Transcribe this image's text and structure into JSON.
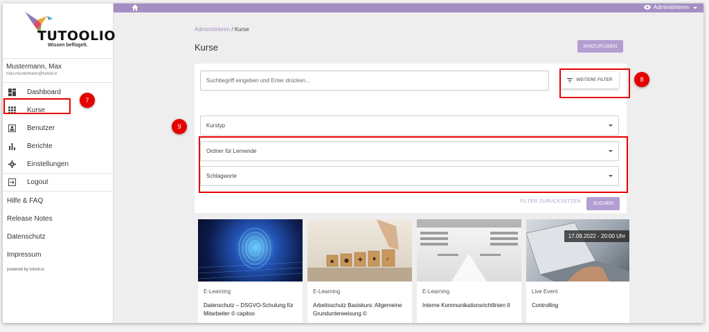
{
  "app": {
    "brand": "TUTOOLIO",
    "tagline": "Wissen beflügelt."
  },
  "user": {
    "name": "Mustermann, Max",
    "email": "max.mustermann@tutool.io"
  },
  "nav": [
    {
      "label": "Dashboard",
      "icon": "dashboard-icon"
    },
    {
      "label": "Kurse",
      "icon": "grid-icon"
    },
    {
      "label": "Benutzer",
      "icon": "user-card-icon"
    },
    {
      "label": "Berichte",
      "icon": "bar-chart-icon"
    },
    {
      "label": "Einstellungen",
      "icon": "gear-icon"
    }
  ],
  "logout": "Logout",
  "links": [
    "Hilfe & FAQ",
    "Release Notes",
    "Datenschutz",
    "Impressum"
  ],
  "powered_by": "powered by tutool.io",
  "topbar": {
    "admin_label": "Administrieren"
  },
  "breadcrumb": {
    "parent": "Administrieren",
    "separator": "/",
    "current": "Kurse"
  },
  "page_title": "Kurse",
  "add_button": "HINZUFÜGEN",
  "search": {
    "placeholder": "Suchbegriff eingeben und Enter drücken..."
  },
  "more_filters": "WEITERE FILTER",
  "selects": {
    "course_type": "Kurstyp",
    "folder": "Ordner für Lernende",
    "tags": "Schlagworte"
  },
  "reset_filters": "FILTER ZURÜCKSETZEN",
  "search_button": "SUCHEN",
  "annotations": {
    "sidebar": "7",
    "filter_button": "8",
    "filters": "9"
  },
  "courses": [
    {
      "type": "E-Learning",
      "title": "Datenschutz – DSGVO-Schulung für Mitarbeiter © capitoo"
    },
    {
      "type": "E-Learning",
      "title": "Arbeitsschutz Basiskurs: Allgemeine Grundunterweisung ©"
    },
    {
      "type": "E-Learning",
      "title": "Interne Kommunikationsrichtlinien II"
    },
    {
      "type": "Live Event",
      "title": "Controlling",
      "date": "17.09.2022 - 20:00 Uhr"
    }
  ],
  "colors": {
    "accent": "#a48fc2",
    "button": "#b39ed2",
    "highlight": "#e60000"
  }
}
